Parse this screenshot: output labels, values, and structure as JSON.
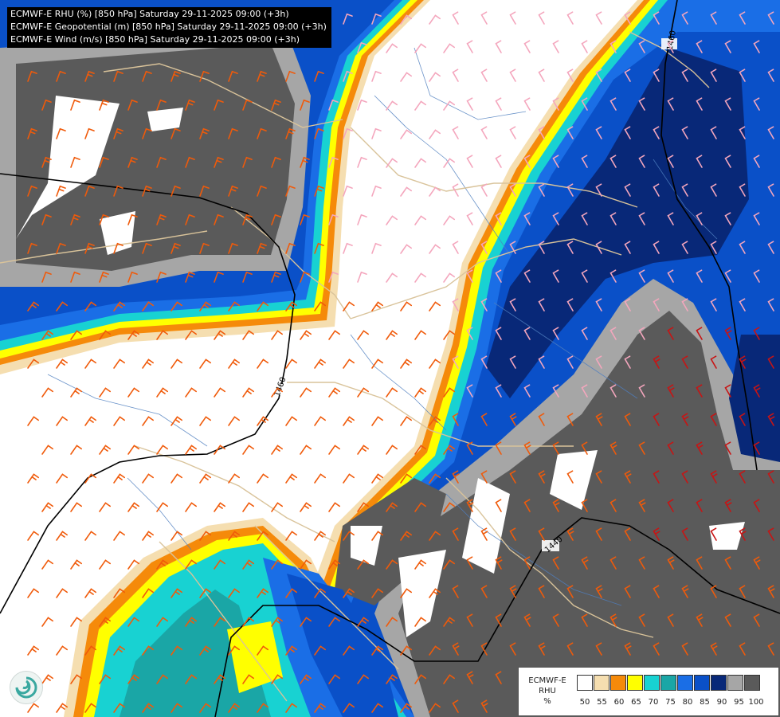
{
  "header": {
    "lines": [
      "ECMWF-E RHU (%) [850 hPa] Saturday 29-11-2025 09:00 (+3h)",
      "ECMWF-E Geopotential (m) [850 hPa] Saturday 29-11-2025 09:00 (+3h)",
      "ECMWF-E Wind (m/s) [850 hPa] Saturday 29-11-2025 09:00 (+3h)"
    ]
  },
  "legend": {
    "title_line1": "ECMWF-E",
    "title_line2": "RHU",
    "unit": "%",
    "colors": [
      "#ffffff",
      "#f5deb0",
      "#f58a0a",
      "#ffff00",
      "#18d2d2",
      "#1aa6a6",
      "#1a6ee6",
      "#0a50c8",
      "#082878",
      "#a6a6a6",
      "#5a5a5a"
    ],
    "ticks": [
      "50",
      "55",
      "60",
      "65",
      "70",
      "75",
      "80",
      "85",
      "90",
      "95",
      "100"
    ]
  },
  "contours": {
    "labels": [
      "1460",
      "1460",
      "1440"
    ]
  },
  "map_layers": {
    "humidity_fill": "shaded",
    "geopotential_isolines": "black",
    "wind_barbs": "colored by speed",
    "borders": "tan",
    "rivers": "steelblue"
  }
}
